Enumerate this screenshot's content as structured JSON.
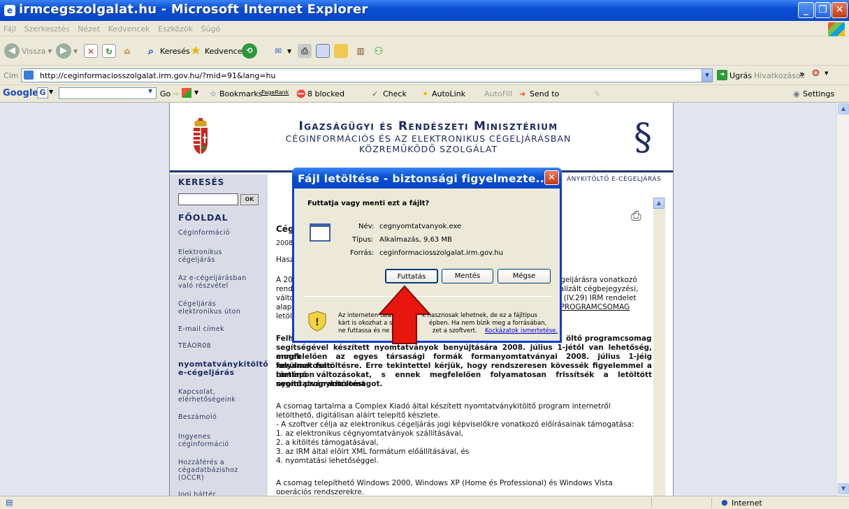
{
  "window": {
    "title": "irmcegszolgalat.hu - Microsoft Internet Explorer"
  },
  "menu": [
    "Fájl",
    "Szerkesztés",
    "Nézet",
    "Kedvencek",
    "Eszközök",
    "Súgó"
  ],
  "toolbar": {
    "back": "Vissza",
    "search": "Keresés",
    "favorites": "Kedvencek"
  },
  "address": {
    "label": "Cím",
    "url": "http://ceginformaciosszolgalat.irm.gov.hu/?mid=91&lang=hu",
    "go": "Ugrás",
    "links": "Hivatkozások"
  },
  "googlebar": {
    "go": "Go",
    "bookmarks": "Bookmarks",
    "pagerank": "PageRank",
    "blocked": "8 blocked",
    "check": "Check",
    "autolink": "AutoLink",
    "autofill": "AutoFill",
    "sendto": "Send to",
    "settings": "Settings"
  },
  "header": {
    "title": "Igazságügyi és Rendészeti Minisztérium",
    "subtitle1": "CÉGINFORMÁCIÓS ÉS AZ ELEKTRONIKUS CÉGELJÁRÁSBAN",
    "subtitle2": "KÖZREMŰKÖDŐ SZOLGÁLAT"
  },
  "nav": {
    "search_heading": "KERESÉS",
    "ok": "OK",
    "main_heading": "FŐOLDAL",
    "items": [
      "Céginformáció",
      "Elektronikus\ncégeljárás",
      "Az e-cégeljárásban\nvaló részvétel",
      "Cégeljárás\nelektronikus úton",
      "E-mail címek",
      "TEÁOR08",
      "nyomtatványkitöltő\ne-cégeljárás",
      "Kapcsolat,\nelérhetőségeink",
      "Beszámoló",
      "Ingyenes\ncéginformáció",
      "Hozzáférés a\ncégadatbázishoz\n(OCCR)",
      "Jogi háttér"
    ]
  },
  "topnav": "ÁNYKITÖLTŐ E-CÉGELJÁRÁS",
  "article": {
    "heading": "Cég",
    "date": "2008",
    "l1": "Hasz",
    "p1": [
      "A 20",
      "rend",
      "válto",
      "alap",
      "letölt"
    ],
    "p1r": [
      "cégeljárásra vonatkozó",
      "tualizált cégbejegyzési,",
      "08 (IV.29) IRM rendelet",
      "Ő  PROGRAMCSOMAG"
    ],
    "bold_a": "Felhí",
    "bold_a_r": "öltő programcsomag",
    "bold_b": "segítségével készített nyomtatványok benyújtására 2008. július 1-jétől van lehetőség, ennek",
    "bold_c": "megfelelően az egyes társasági formák formanyomtatványai 2008. július 1-jéig folyamatosan",
    "bold_d": "kerülnek feltöltésre. Erre tekintettel kérjük, hogy rendszeresen kövessék figyelemmel a honlapon",
    "bold_e": "történő változásokat, s ennek megfelelően folyamatosan frissítsék a letöltött nyomtatványkitöltést",
    "bold_f": "segítő programcsomagot.",
    "p3a": "A csomag tartalma a Complex Kiadó által készített nyomtatványkitöltő program internetről",
    "p3b": "letölthető, digitálisan aláírt telepítő készlete.",
    "p3c": "- A szoftver célja az elektronikus cégeljárás jogi képviselőkre vonatkozó előírásainak támogatása:",
    "p3d": "1. az elektronikus cégnyomtatványok szállításával,",
    "p3e": "2. a kitöltés támogatásával,",
    "p3f": "3. az IRM által előírt XML formátum előállításával, és",
    "p3g": "4. nyomtatási lehetőséggel.",
    "p4": "A csomag telepíthető Windows 2000, Windows XP (Home és Professional) és Windows Vista",
    "p5": "operációs rendszerekre."
  },
  "dialog": {
    "title": "Fájl letöltése - biztonsági figyelmezte...",
    "question": "Futtatja vagy menti ezt a fájlt?",
    "name_label": "Név:",
    "name": "cegnyomtatvanyok.exe",
    "type_label": "Típus:",
    "type": "Alkalmazás, 9,63 MB",
    "source_label": "Forrás:",
    "source": "ceginformaciosszolgalat.irm.gov.hu",
    "run": "Futtatás",
    "save": "Mentés",
    "cancel": "Mégse",
    "warn1": "Az interneten talál",
    "warn1b": "k hasznosak lehetnek, de ez a fájltípus",
    "warn2": "kárt is okozhat a sz",
    "warn2b": "épben. Ha nem bízik meg a forrásában,",
    "warn3": "ne futtassa és ne m",
    "warn3b": "zet a szoftvert.",
    "risk_link": "Kockázatok ismertetése."
  },
  "status": {
    "zone": "Internet"
  },
  "colors": {
    "titlebar": "#0a4fd6",
    "arrow": "#e8160c",
    "header_navy": "#1e2a63"
  }
}
